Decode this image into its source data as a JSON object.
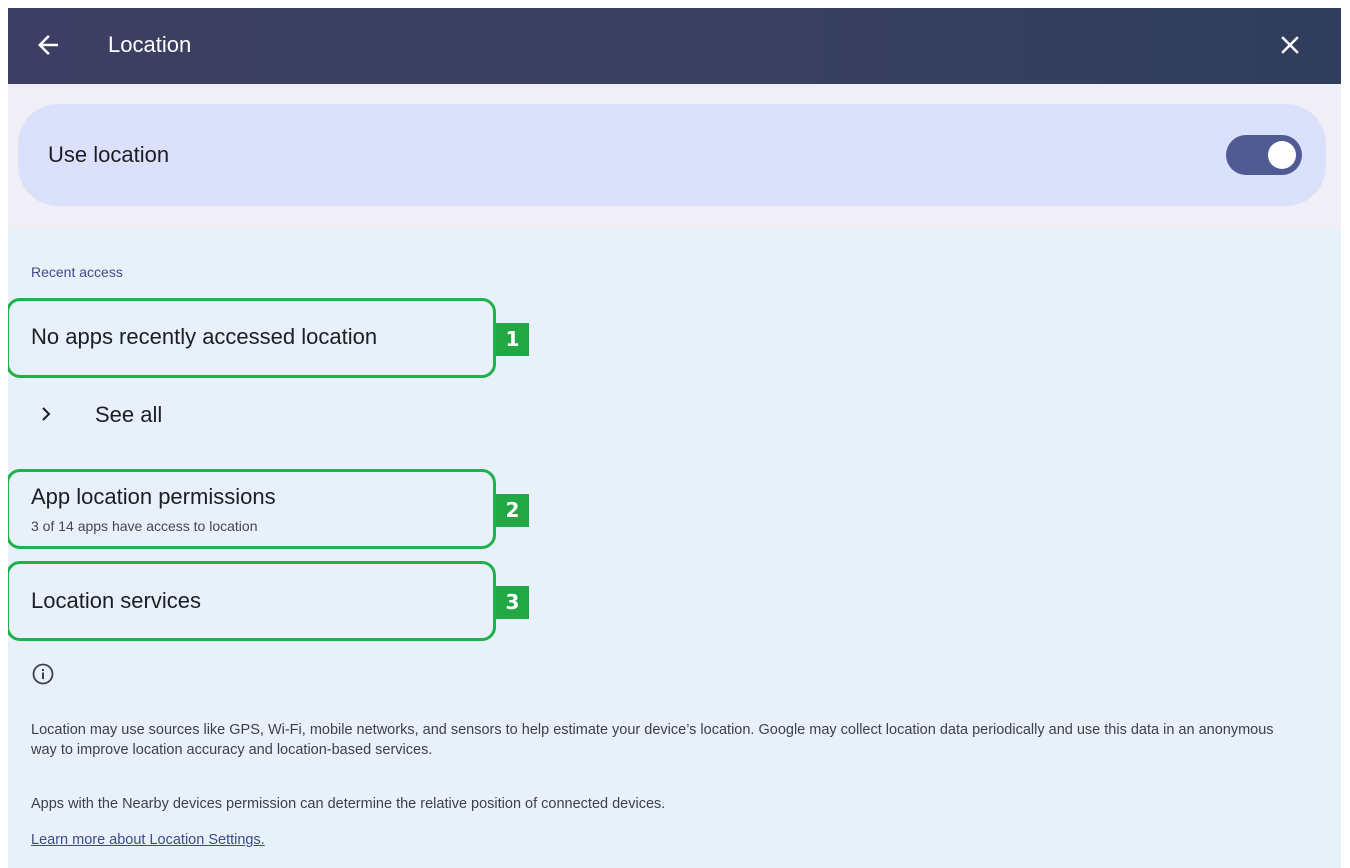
{
  "header": {
    "title": "Location",
    "back_icon": "arrow-left-icon",
    "close_icon": "close-icon"
  },
  "use_location": {
    "label": "Use location",
    "toggle_on": true
  },
  "recent_access": {
    "section_label": "Recent access",
    "empty_message": "No apps recently accessed location",
    "see_all_label": "See all"
  },
  "app_permissions": {
    "title": "App location permissions",
    "subtitle": "3 of 14 apps have access to location"
  },
  "location_services": {
    "title": "Location services"
  },
  "annotations": [
    "1",
    "2",
    "3"
  ],
  "footer": {
    "info_icon": "info-icon",
    "description": "Location may use sources like GPS, Wi-Fi, mobile networks, and sensors to help estimate your device’s location. Google may collect location data periodically and use this data in an anonymous way to improve location accuracy and location-based services.",
    "nearby_note": "Apps with the Nearby devices permission can determine the relative position of connected devices.",
    "learn_more": "Learn more about Location Settings."
  },
  "colors": {
    "header_bg": "#3c3f63",
    "card_bg": "#dbe0fb",
    "toggle_on": "#4f5b92",
    "page_bg": "#e8f1fa",
    "annotation_green": "#22a745"
  }
}
